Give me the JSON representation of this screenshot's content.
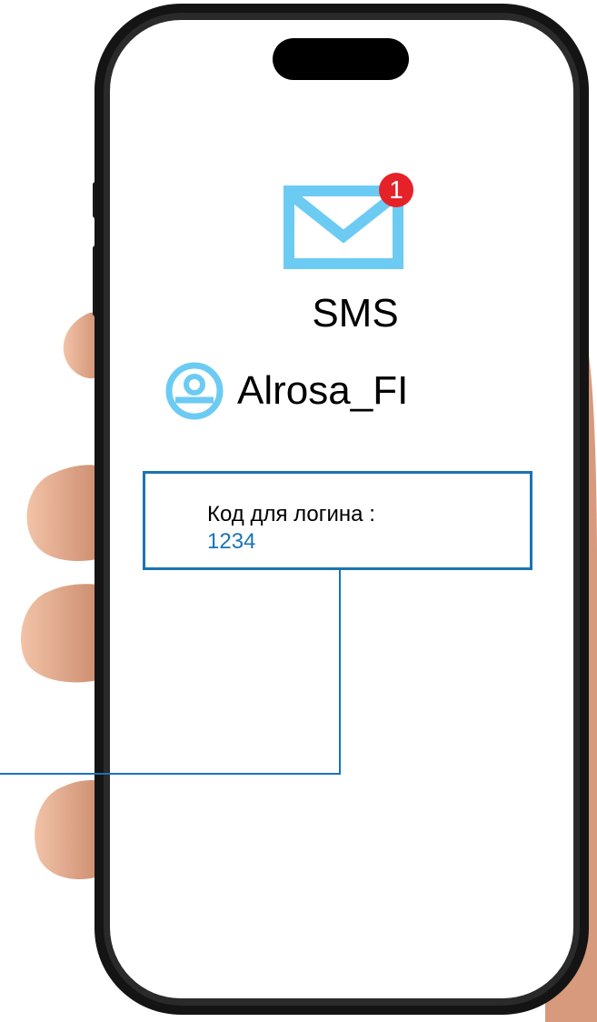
{
  "app": {
    "title": "SMS",
    "unread_count": "1"
  },
  "message": {
    "sender": "Alrosa_FI",
    "text": "Код для логина :",
    "code": "1234"
  },
  "icons": {
    "mail": "envelope-icon",
    "avatar": "user-avatar-icon"
  },
  "colors": {
    "envelope": "#6ccbf3",
    "badge": "#e52228",
    "accent_blue": "#1a73b5",
    "phone_frame": "#111111",
    "skin": "#e7a98a"
  }
}
